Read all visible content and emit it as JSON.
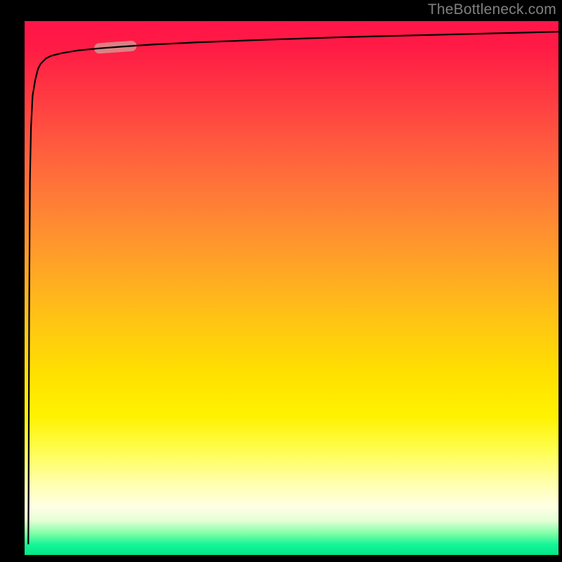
{
  "watermark": "TheBottleneck.com",
  "chart_data": {
    "type": "line",
    "title": "",
    "xlabel": "",
    "ylabel": "",
    "xlim": [
      0,
      100
    ],
    "ylim": [
      0,
      100
    ],
    "grid": false,
    "legend": false,
    "gradient_colors": {
      "top": "#ff1548",
      "mid_upper": "#ff7e36",
      "mid": "#ffe000",
      "mid_lower": "#ffffe5",
      "bottom": "#00e888"
    },
    "series": [
      {
        "name": "curve",
        "x": [
          0.7,
          0.75,
          0.85,
          1.0,
          1.2,
          1.5,
          2,
          2.5,
          3,
          4,
          5,
          7,
          10,
          14,
          18,
          24,
          32,
          45,
          60,
          80,
          100
        ],
        "values": [
          2,
          12,
          45,
          70,
          80,
          86,
          89,
          91,
          92,
          93,
          93.5,
          94,
          94.5,
          94.9,
          95.2,
          95.6,
          96.0,
          96.5,
          97.0,
          97.5,
          98.0
        ]
      }
    ],
    "highlight_segment": {
      "x_range": [
        14,
        20
      ],
      "y_approx": 95,
      "color": "#d6938f"
    }
  }
}
